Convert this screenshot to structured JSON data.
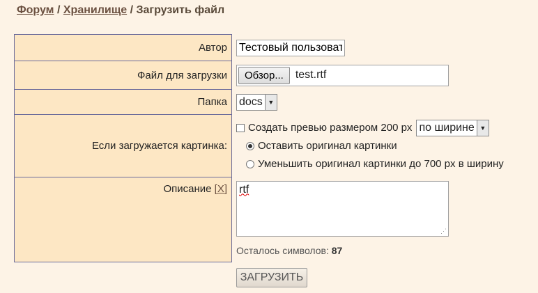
{
  "breadcrumb": {
    "forum": "Форум",
    "storage": "Хранилище",
    "current": "Загрузить файл",
    "sep": "/"
  },
  "form": {
    "author_label": "Автор",
    "author_value": "Тестовый пользователь",
    "file_label": "Файл для загрузки",
    "file_button": "Обзор...",
    "file_name": "test.rtf",
    "folder_label": "Папка",
    "folder_value": "docs",
    "image_label": "Если загружается картинка:",
    "preview_label": "Создать превью размером 200 px",
    "preview_checked": false,
    "preview_mode": "по ширине",
    "radio_keep": "Оставить оригинал картинки",
    "radio_shrink": "Уменьшить оригинал картинки до 700 px в ширину",
    "radio_selected": "keep",
    "description_label": "Описание",
    "description_clear": "[X]",
    "description_value": "rtf",
    "remaining_label": "Осталось символов:",
    "remaining_count": "87",
    "submit_label": "ЗАГРУЗИТЬ"
  },
  "colors": {
    "label_bg": "#fde7c4",
    "page_bg": "#fdf3e6",
    "link": "#6b5040"
  }
}
